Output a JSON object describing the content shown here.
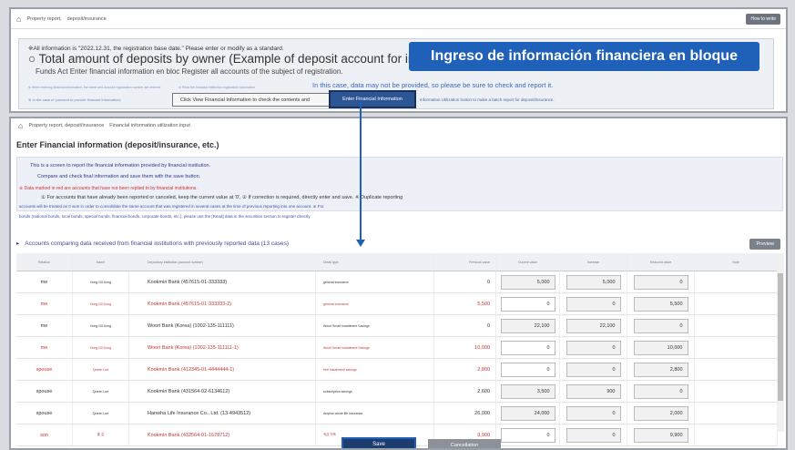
{
  "top": {
    "breadcrumb_1": "Property report,",
    "breadcrumb_2": "deposit/insurance",
    "howto_label": "How to write",
    "line1": "※All information is \"2022.12.31, the registration base date.\" Please enter or modify as a standard.",
    "big_text": "○ Total amount of deposits by owner (Example of deposit account for inc",
    "sub_text": "Funds Act Enter financial information en bloc Register all accounts of the subject of registration.",
    "small_blue_1": "※ When entering financial information, the name and account registration number are entered",
    "small_blue_2": "※ Read the financial institution registration information",
    "case_text": "In this case, data may not be provided, so please be sure to check and report it.",
    "small_note": "※ In the case of (consent to provide financial information)",
    "view_fin_label": "Click View Financial Information to check the contents and",
    "enter_fin_label": "Enter Financial Information",
    "util_text": "Information Utilization button to make a batch report for deposit/insurance."
  },
  "callout": "Ingreso de información financiera en bloque",
  "bottom": {
    "breadcrumb_1": "Property report, deposit/insurance",
    "breadcrumb_2": "Financial information utilization input",
    "title": "Enter Financial information (deposit/insurance, etc.)",
    "n1": "This is a screen to report the financial information provided by financial institution.",
    "n2": "Compare and check final information and save them with the save button.",
    "n3": "※ Data marked in red are accounts that have not been replied to by financial institutions.",
    "n4": "① For accounts that have already been reported or canceled, keep the current value at '0', ② If correction is required, directly enter and save. ※ Duplicate reporting",
    "n5": "accounts will be treated as 0 won in order to consolidate the same account that was registered in several cases at the time of previous reporting into one account. ※ For",
    "n6": "bonds (national bonds, local bonds, special bonds, financial bonds, corporate bonds, etc.), please use the [Read] data in the securities section to register directly.",
    "section": "Accounts comparing data received from financial institutions with previously reported data (13 cases)",
    "preview_label": "Preview",
    "headers": [
      "Relation",
      "Name",
      "Depository institution (account number)",
      "Detail type",
      "Previous value",
      "Current value",
      "Increase",
      "Reduced value",
      "Note"
    ],
    "rows": [
      {
        "rel": "me",
        "name": "Hong Gil Dong",
        "bank": "Kookmin Bank (457615-01-333333)",
        "type": "general insurance",
        "prev": "0",
        "cur": "5,000",
        "inc": "5,000",
        "red": "0",
        "red_row": false
      },
      {
        "rel": "me",
        "name": "Hong Gil Dong",
        "bank": "Kookmin Bank (457615-01-333333-2)",
        "type": "general insurance",
        "prev": "5,500",
        "cur": "0",
        "inc": "0",
        "red": "5,500",
        "red_row": true
      },
      {
        "rel": "me",
        "name": "Hong Gil Dong",
        "bank": "Woori Bank (Korea) (1002-135-111111)",
        "type": "Woori Smart Installment Savings",
        "prev": "0",
        "cur": "22,100",
        "inc": "22,100",
        "red": "0",
        "red_row": false
      },
      {
        "rel": "me",
        "name": "Hong Gil Dong",
        "bank": "Woori Bank (Korea) (1002-135-111111-1)",
        "type": "Woori Smart Installment Savings",
        "prev": "10,000",
        "cur": "0",
        "inc": "0",
        "red": "10,000",
        "red_row": true
      },
      {
        "rel": "spouse",
        "name": "Queen Lee",
        "bank": "Kookmin Bank (412345-01-4444444-1)",
        "type": "free installment savings",
        "prev": "2,800",
        "cur": "0",
        "inc": "0",
        "red": "2,800",
        "red_row": true
      },
      {
        "rel": "spouse",
        "name": "Queen Lee",
        "bank": "Kookmin Bank (431564-02-6134612)",
        "type": "subscription savings",
        "prev": "2,600",
        "cur": "3,500",
        "inc": "900",
        "red": "0",
        "red_row": false
      },
      {
        "rel": "spouse",
        "name": "Queen Lee",
        "bank": "Hanwha Life Insurance Co., Ltd. (13-4943512)",
        "type": "Amplus whole life insurance",
        "prev": "26,000",
        "cur": "24,000",
        "inc": "0",
        "red": "2,000",
        "red_row": false
      },
      {
        "rel": "son",
        "name": "홍 길",
        "bank": "Kookmin Bank (432564-01-1678712)",
        "type": "적금 저축",
        "prev": "9,900",
        "cur": "0",
        "inc": "0",
        "red": "9,900",
        "red_row": true
      }
    ],
    "save_label": "Save",
    "cancel_label": "Cancellation"
  },
  "colors": {
    "accent": "#1f61b9",
    "button_dark": "#1d3c6f",
    "red_text": "#cc3333"
  }
}
